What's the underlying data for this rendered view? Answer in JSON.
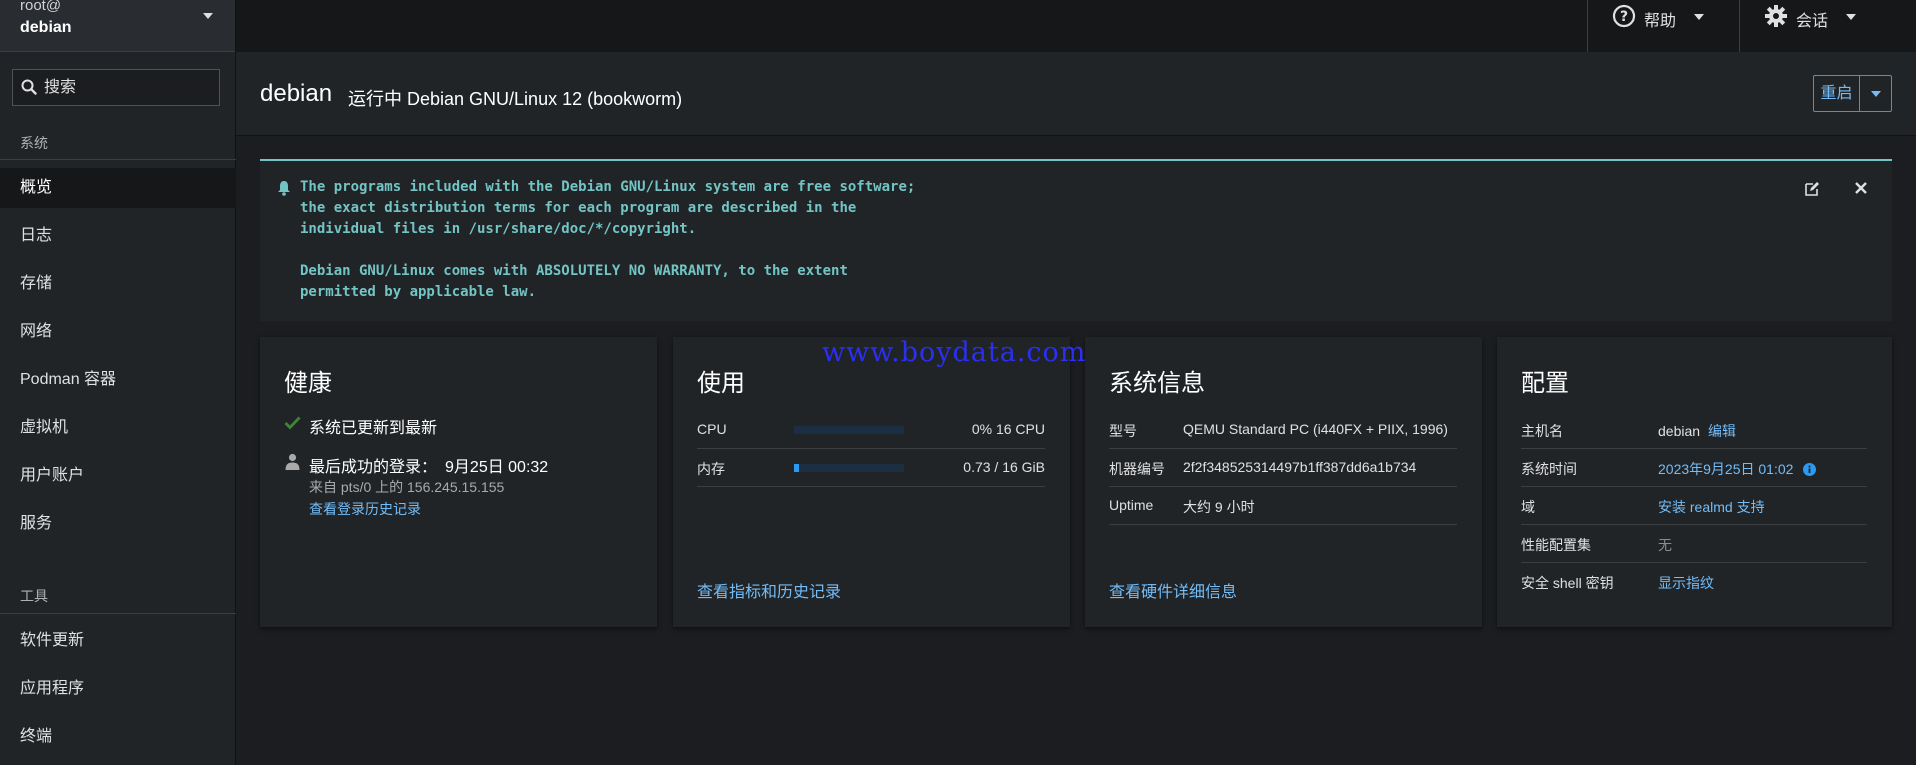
{
  "host": {
    "user": "root@",
    "name": "debian"
  },
  "sidebar": {
    "search_placeholder": "搜索",
    "section_system": "系统",
    "items_system": [
      "概览",
      "日志",
      "存储",
      "网络",
      "Podman 容器",
      "虚拟机",
      "用户账户",
      "服务"
    ],
    "section_tools": "工具",
    "items_tools": [
      "软件更新",
      "应用程序",
      "终端"
    ]
  },
  "topbar": {
    "help": "帮助",
    "session": "会话"
  },
  "header": {
    "title": "debian",
    "subtitle": "运行中 Debian GNU/Linux 12 (bookworm)",
    "restart": "重启"
  },
  "motd": {
    "lines": [
      "The programs included with the Debian GNU/Linux system are free software;",
      "the exact distribution terms for each program are described in the",
      "individual files in /usr/share/doc/*/copyright.",
      "",
      "Debian GNU/Linux comes with ABSOLUTELY NO WARRANTY, to the extent",
      "permitted by applicable law."
    ]
  },
  "health": {
    "title": "健康",
    "updated": "系统已更新到最新",
    "last_login_label": "最后成功的登录：",
    "last_login_time": "9月25日 00:32",
    "last_login_from": "来自 pts/0 上的 156.245.15.155",
    "history_link": "查看登录历史记录"
  },
  "usage": {
    "title": "使用",
    "cpu_label": "CPU",
    "cpu_value": "0% 16 CPU",
    "cpu_fraction": 0.0,
    "mem_label": "内存",
    "mem_value": "0.73 / 16 GiB",
    "mem_fraction": 0.0456,
    "link": "查看指标和历史记录"
  },
  "sysinfo": {
    "title": "系统信息",
    "model_label": "型号",
    "model_value": "QEMU Standard PC (i440FX + PIIX, 1996)",
    "machine_label": "机器编号",
    "machine_value": "2f2f348525314497b1ff387dd6a1b734",
    "uptime_label": "Uptime",
    "uptime_value": "大约 9 小时",
    "link": "查看硬件详细信息"
  },
  "config": {
    "title": "配置",
    "hostname_label": "主机名",
    "hostname_value": "debian",
    "hostname_edit": "编辑",
    "time_label": "系统时间",
    "time_value": "2023年9月25日 01:02",
    "domain_label": "域",
    "domain_value": "安装 realmd 支持",
    "profile_label": "性能配置集",
    "profile_value": "无",
    "ssh_label": "安全 shell 密钥",
    "ssh_value": "显示指纹"
  },
  "watermark": "www.boydata.com",
  "colors": {
    "accent": "#73bcf7",
    "motd": "#73c5c5",
    "success": "#3e8635"
  }
}
